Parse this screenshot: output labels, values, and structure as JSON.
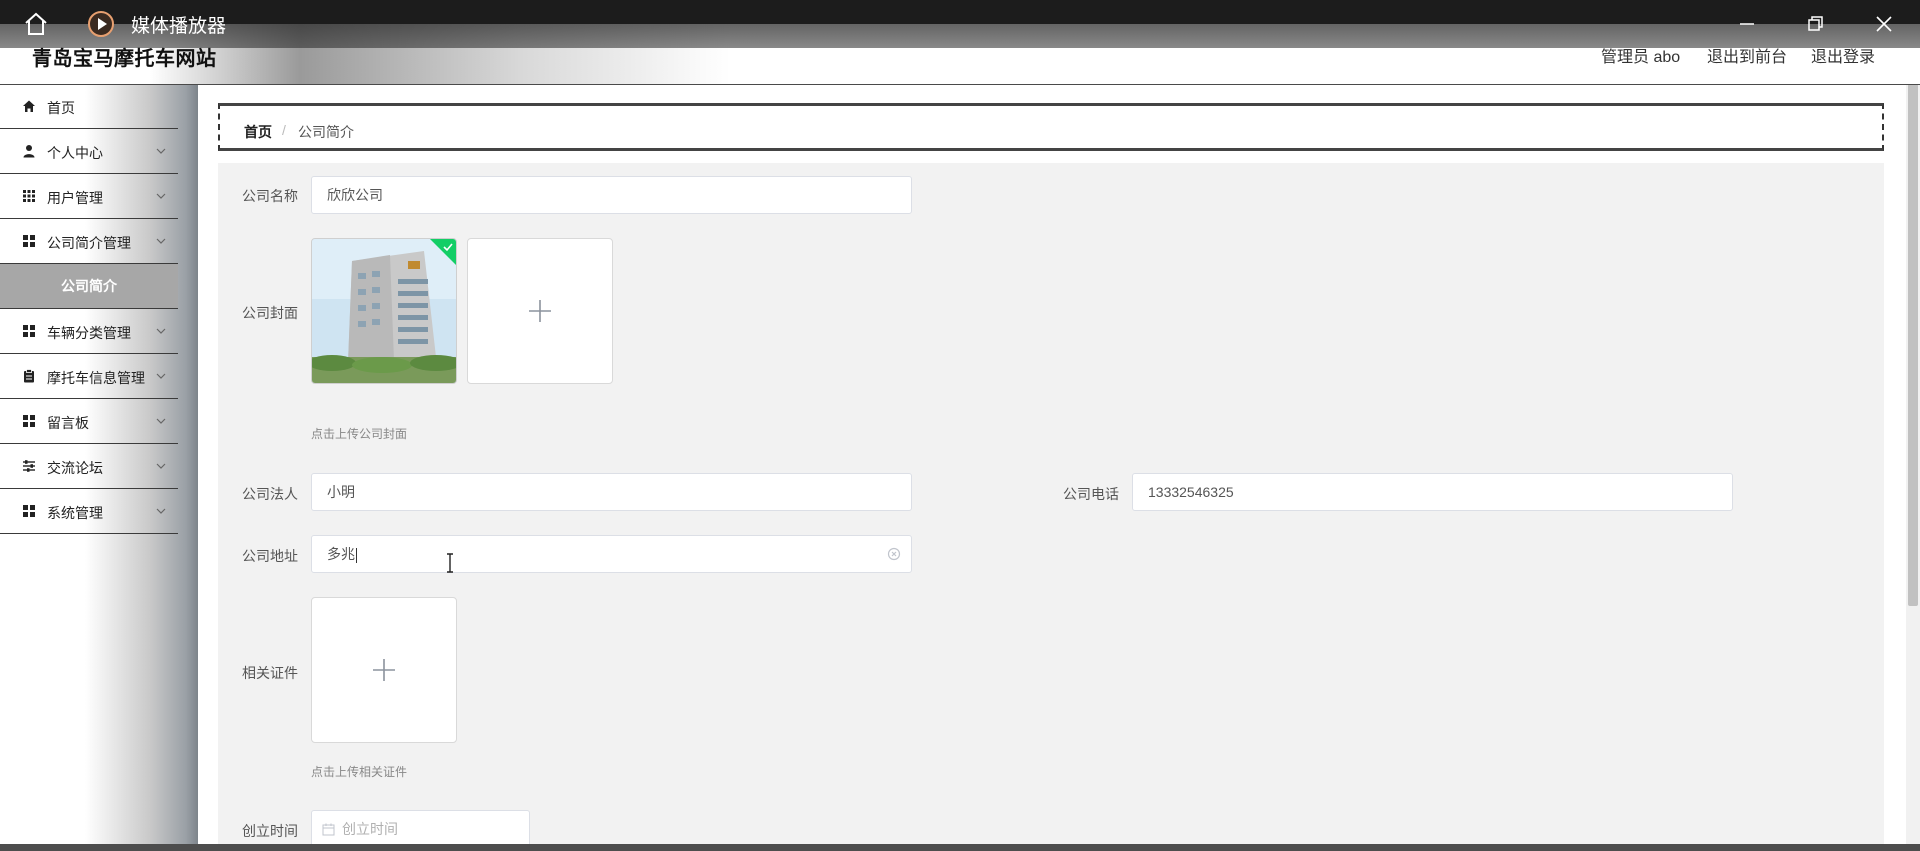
{
  "media_player": {
    "title": "媒体播放器"
  },
  "header": {
    "site_title": "青岛宝马摩托车网站",
    "admin_label": "管理员 abo",
    "back_to_front": "退出到前台",
    "logout": "退出登录"
  },
  "sidebar": {
    "items": [
      {
        "label": "首页",
        "icon": "home-icon",
        "has_arrow": false
      },
      {
        "label": "个人中心",
        "icon": "user-icon",
        "has_arrow": true
      },
      {
        "label": "用户管理",
        "icon": "grid-icon",
        "has_arrow": true
      },
      {
        "label": "公司简介管理",
        "icon": "apps-icon",
        "has_arrow": true
      },
      {
        "label": "车辆分类管理",
        "icon": "apps-icon",
        "has_arrow": true
      },
      {
        "label": "摩托车信息管理",
        "icon": "clipboard-icon",
        "has_arrow": true
      },
      {
        "label": "留言板",
        "icon": "apps-icon",
        "has_arrow": true
      },
      {
        "label": "交流论坛",
        "icon": "sliders-icon",
        "has_arrow": true
      },
      {
        "label": "系统管理",
        "icon": "apps-icon",
        "has_arrow": true
      }
    ],
    "active_sub": "公司简介"
  },
  "breadcrumb": {
    "home": "首页",
    "separator": "/",
    "current": "公司简介"
  },
  "form": {
    "name_label": "公司名称",
    "name_value": "欣欣公司",
    "cover_label": "公司封面",
    "cover_hint": "点击上传公司封面",
    "legal_label": "公司法人",
    "legal_value": "小明",
    "phone_label": "公司电话",
    "phone_value": "13332546325",
    "address_label": "公司地址",
    "address_value": "多兆",
    "license_label": "相关证件",
    "license_hint": "点击上传相关证件",
    "founded_label": "创立时间",
    "founded_placeholder": "创立时间"
  },
  "colors": {
    "accent_check": "#13ce66",
    "panel_bg": "#f2f2f2"
  }
}
